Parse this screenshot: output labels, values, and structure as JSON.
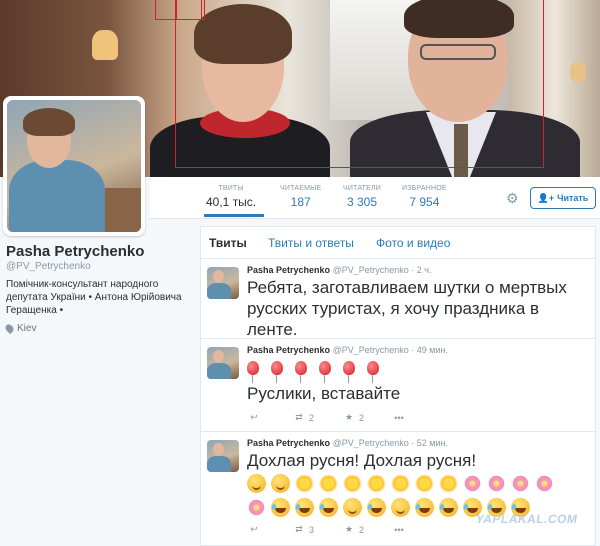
{
  "profile": {
    "name": "Pasha Petrychenko",
    "handle": "@PV_Petrychenko",
    "bio": "Помічник-консультант народного депутата України • Антона Юрійовича Геращенка •",
    "location": "Kiev"
  },
  "stats": [
    {
      "label": "ТВИТЫ",
      "value": "40,1 тыс."
    },
    {
      "label": "ЧИТАЕМЫЕ",
      "value": "187"
    },
    {
      "label": "ЧИТАТЕЛИ",
      "value": "3 305"
    },
    {
      "label": "ИЗБРАННОЕ",
      "value": "7 954"
    }
  ],
  "follow_label": "Читать",
  "tabs": [
    "Твиты",
    "Твиты и ответы",
    "Фото и видео"
  ],
  "tweets": [
    {
      "name": "Pasha Petrychenko",
      "handle": "@PV_Petrychenko",
      "time": "2 ч.",
      "text": "Ребята, заготавливаем шутки о мертвых русских туристах, я хочу праздника в ленте."
    },
    {
      "name": "Pasha Petrychenko",
      "handle": "@PV_Petrychenko",
      "time": "49 мин.",
      "text": "Руслики, вставайте",
      "retweets": "2",
      "favorites": "2"
    },
    {
      "name": "Pasha Petrychenko",
      "handle": "@PV_Petrychenko",
      "time": "52 мин.",
      "text": "Дохлая русня! Дохлая русня!",
      "retweets": "3",
      "favorites": "2"
    }
  ],
  "watermark": "YAPLAKAL.COM",
  "colors": {
    "link": "#2b7bb9",
    "muted": "#8899a6",
    "highlight_box": "#d2232a"
  }
}
